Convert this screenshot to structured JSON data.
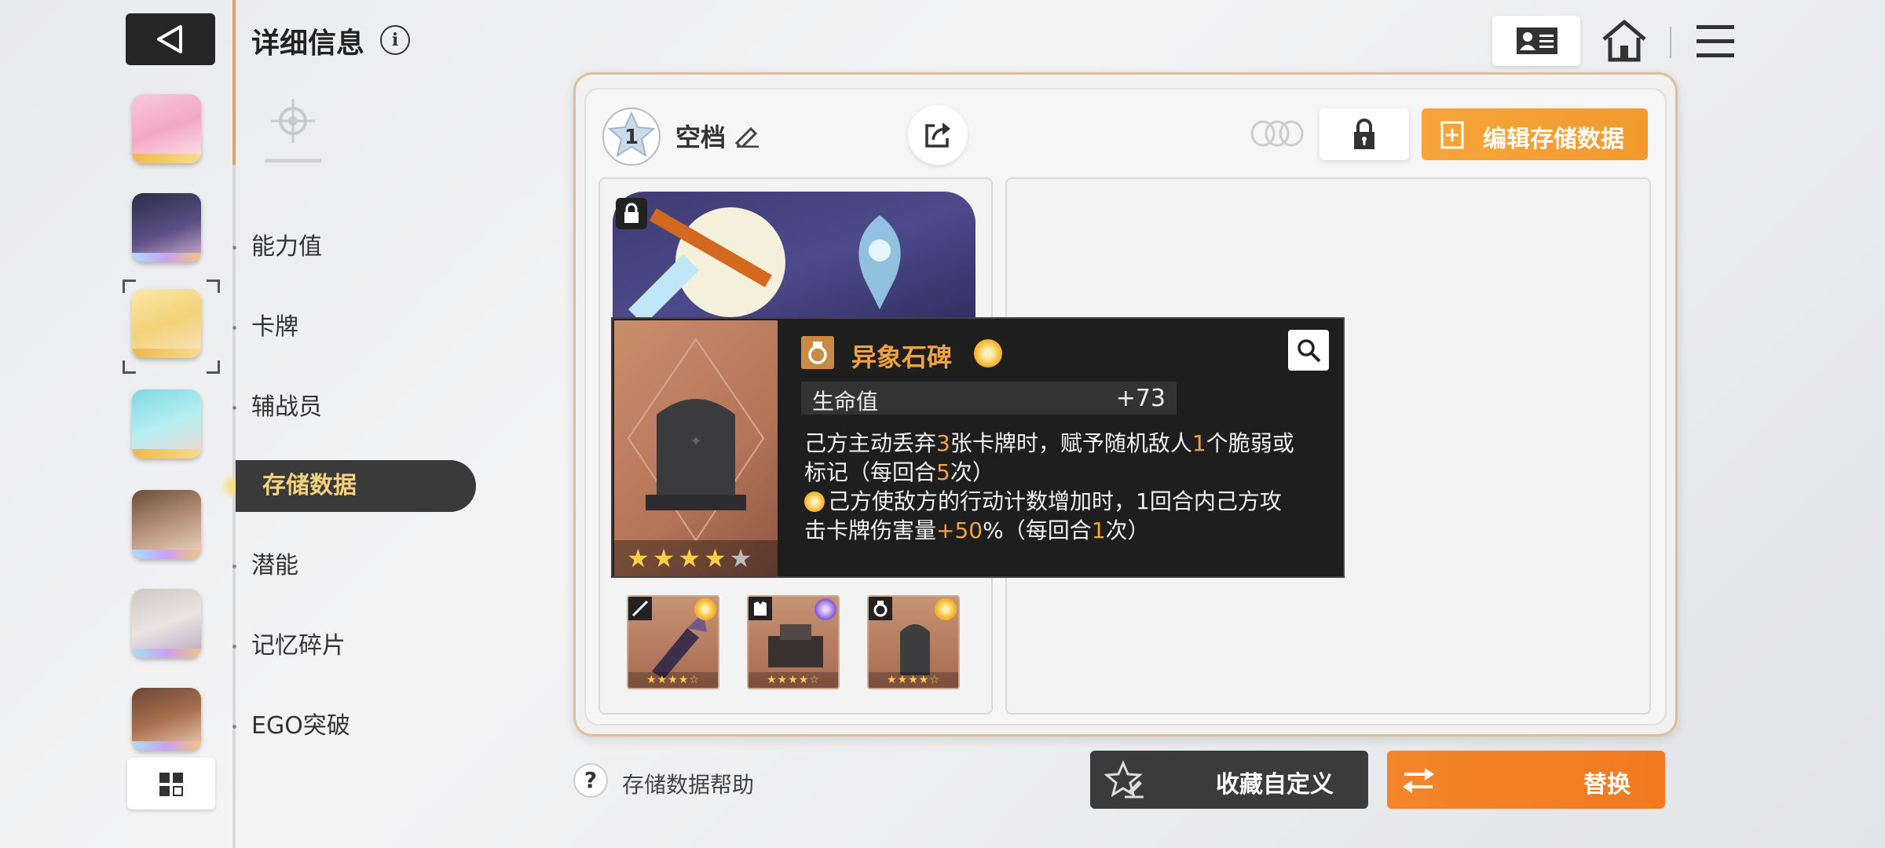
{
  "header": {
    "title": "详细信息",
    "info_icon": "info-icon"
  },
  "nav": {
    "items": [
      "能力值",
      "卡牌",
      "辅战员",
      "存储数据",
      "潜能",
      "记忆碎片",
      "EGO突破"
    ],
    "active_index": 3
  },
  "slot": {
    "number": "1",
    "name": "空档"
  },
  "buttons": {
    "edit_save": "编辑存储数据",
    "help": "存储数据帮助",
    "favorite": "收藏自定义",
    "swap": "替换"
  },
  "tooltip": {
    "item_name": "异象石碑",
    "stat_label": "生命值",
    "stat_value": "+73",
    "stars_filled": 4,
    "stars_total": 5,
    "desc1_a": "己方主动丢弃",
    "desc1_n1": "3",
    "desc1_b": "张卡牌时，赋予随机敌人",
    "desc1_n2": "1",
    "desc1_c": "个脆弱或",
    "desc1_d": "标记（每回合",
    "desc1_n3": "5",
    "desc1_e": "次）",
    "desc2_a": "己方使敌方的行动计数增加时，1回合内己方攻",
    "desc2_b": "击卡牌伤害量",
    "desc2_n1": "+50",
    "desc2_c": "%（每回合",
    "desc2_n2": "1",
    "desc2_d": "次）"
  },
  "colors": {
    "accent_orange": "#f29a2e",
    "highlight": "#f3a53c",
    "dark_button": "#3b3b3b"
  }
}
